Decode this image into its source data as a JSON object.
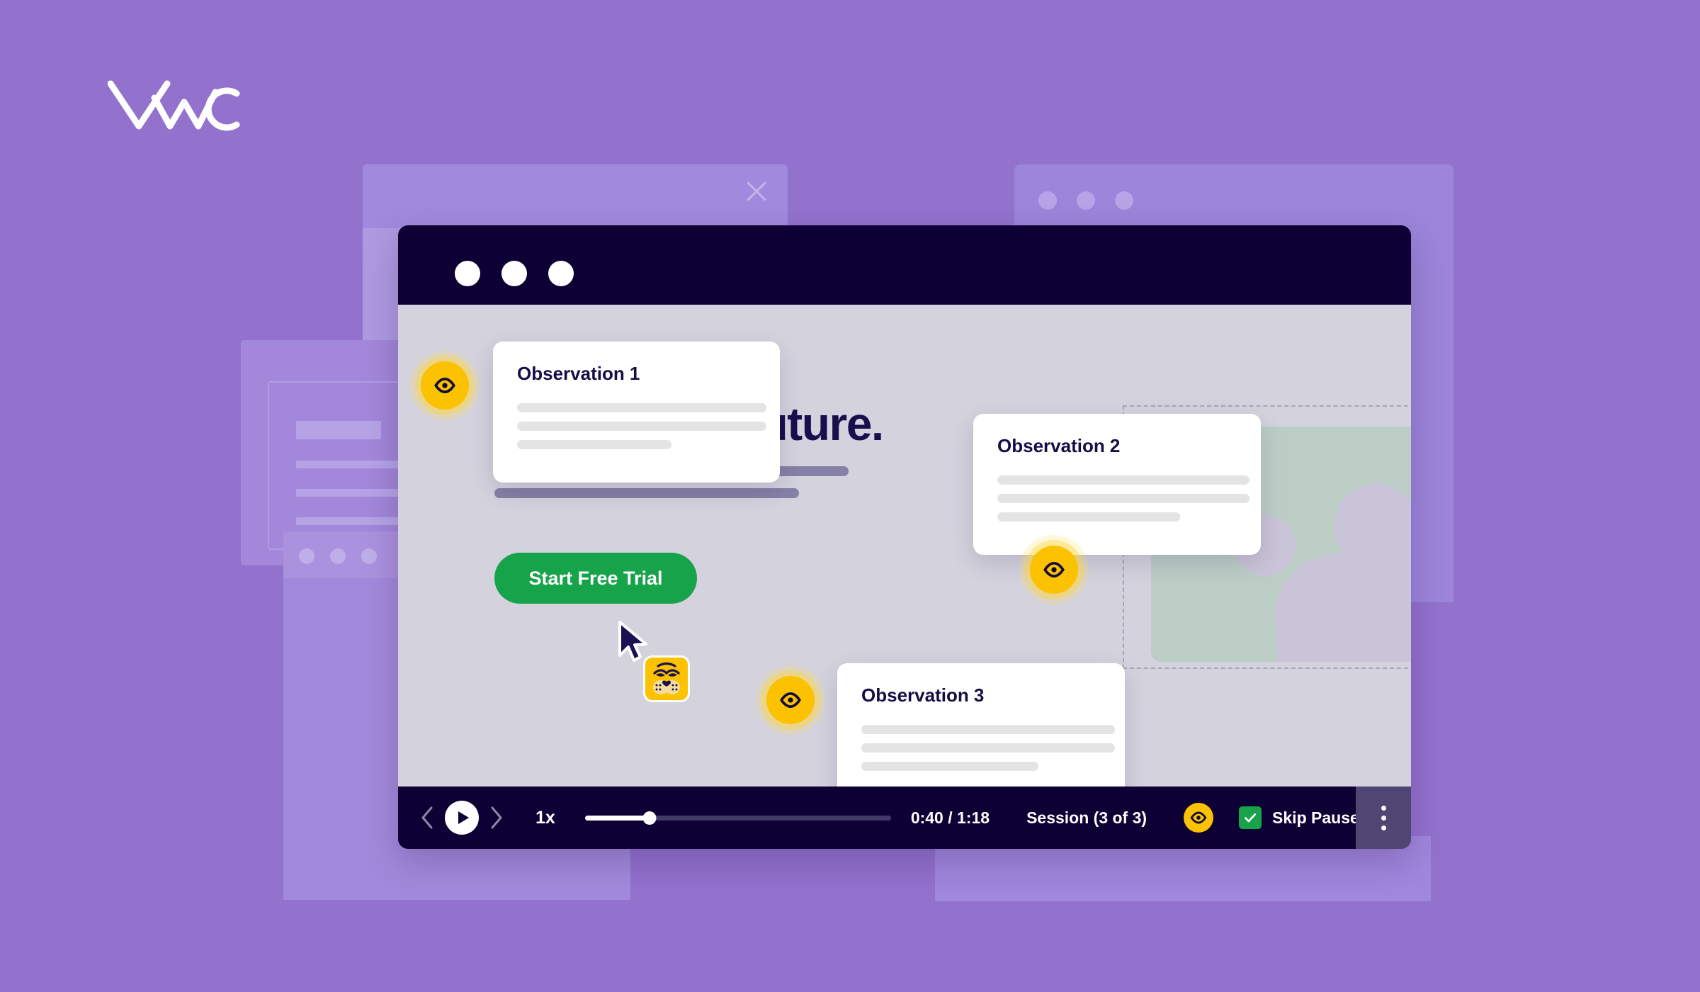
{
  "brand": {
    "logo_text": "VWO",
    "logo_name": "vwo-logo",
    "background_color": "#9272cd"
  },
  "window": {
    "titlebar_dots": 3,
    "titlebar_color": "#0c0035",
    "body_color": "#d4d2dd"
  },
  "hero": {
    "heading": "...ur mind,\nshape your future.",
    "cta_label": "Start Free Trial",
    "cta_color": "#16a34a"
  },
  "observations": [
    {
      "title": "Observation 1",
      "pin_icon": "eye-icon"
    },
    {
      "title": "Observation 2",
      "pin_icon": "eye-icon"
    },
    {
      "title": "Observation 3",
      "pin_icon": "eye-icon"
    }
  ],
  "pointer": {
    "cursor_icon": "mouse-cursor-icon",
    "avatar_icon": "tiger-face-avatar-icon",
    "avatar_color": "#fcc200"
  },
  "player": {
    "prev_icon": "chevron-left-icon",
    "play_icon": "play-icon",
    "next_icon": "chevron-right-icon",
    "speed": "1x",
    "progress_percent": 21,
    "time": "0:40 / 1:18",
    "session": "Session (3 of 3)",
    "eye_icon": "eye-icon",
    "skip_pauses_label": "Skip Pauses",
    "skip_pauses_checked": true,
    "menu_icon": "kebab-menu-icon",
    "accent_yellow": "#fcc200",
    "accent_green": "#17a34a",
    "bar_color": "#0c0035"
  },
  "placeholder_image": {
    "icon": "person-image-placeholder",
    "fill_color": "#bccdc6"
  }
}
